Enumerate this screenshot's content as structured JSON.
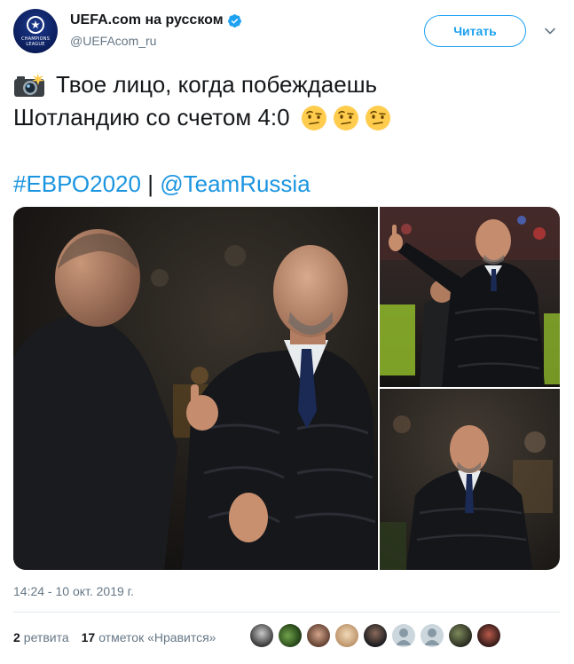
{
  "author": {
    "display_name": "UEFA.com на русском",
    "handle": "@UEFAcom_ru",
    "avatar_text_line1": "CHAMPIONS",
    "avatar_text_line2": "LEAGUE",
    "verified": true
  },
  "follow_button": {
    "label": "Читать"
  },
  "tweet": {
    "line1": "Твое лицо, когда побеждаешь",
    "line2": "Шотландию со счетом 4:0",
    "hashtag": "#ЕВРО2020",
    "separator": "|",
    "mention": "@TeamRussia",
    "emojis": [
      "camera-flash-icon",
      "face-with-raised-eyebrow-icon",
      "face-with-raised-eyebrow-icon",
      "face-with-raised-eyebrow-icon"
    ]
  },
  "media": {
    "photo_count": 3
  },
  "timestamp": "14:24 - 10 окт. 2019 г.",
  "stats": {
    "retweets_count": "2",
    "retweets_label": "ретвита",
    "likes_count": "17",
    "likes_label": "отметок «Нравится»",
    "liker_avatar_count": 9
  },
  "colors": {
    "accent": "#1da1f2",
    "link": "#1b95e0",
    "text": "#14171a",
    "secondary_text": "#657786",
    "divider": "#e6ecf0",
    "verified_badge": "#1da1f2"
  }
}
